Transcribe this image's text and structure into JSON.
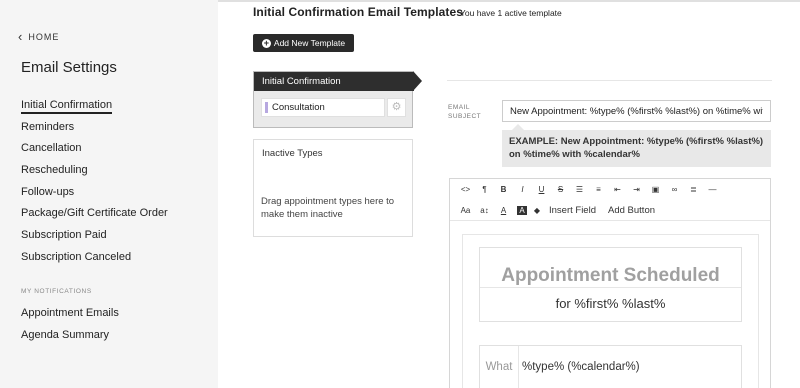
{
  "sidebar": {
    "home_label": "HOME",
    "title": "Email Settings",
    "items": [
      {
        "label": "Initial Confirmation"
      },
      {
        "label": "Reminders"
      },
      {
        "label": "Cancellation"
      },
      {
        "label": "Rescheduling"
      },
      {
        "label": "Follow-ups"
      },
      {
        "label": "Package/Gift Certificate Order"
      },
      {
        "label": "Subscription Paid"
      },
      {
        "label": "Subscription Canceled"
      }
    ],
    "section_label": "MY NOTIFICATIONS",
    "notification_items": [
      {
        "label": "Appointment Emails"
      },
      {
        "label": "Agenda Summary"
      }
    ]
  },
  "main": {
    "title": "Initial Confirmation Email Templates",
    "active_count": "You have 1 active template",
    "add_button": "Add New Template",
    "template": {
      "name": "Initial Confirmation",
      "type": "Consultation"
    },
    "inactive": {
      "title": "Inactive Types",
      "hint": "Drag appointment types here to make them inactive"
    },
    "subject": {
      "label": "EMAIL SUBJECT",
      "value": "New Appointment: %type% (%first% %last%) on %time% with %calendar%",
      "example": "EXAMPLE: New Appointment: %type% (%first% %last%) on %time% with %calendar%"
    },
    "editor": {
      "toolbar": {
        "insert_field": "Insert Field",
        "add_button": "Add Button"
      },
      "preview": {
        "heading": "Appointment Scheduled",
        "subheading": "for %first% %last%",
        "row_label": "What",
        "row_value": "%type% (%calendar%)"
      }
    }
  }
}
